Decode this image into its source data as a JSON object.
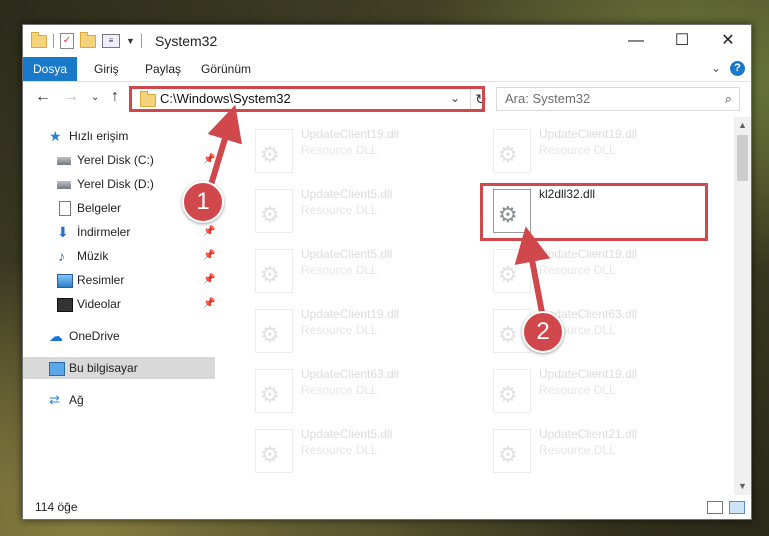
{
  "window": {
    "title": "System32",
    "controls": {
      "minimize": "—",
      "maximize": "☐",
      "close": "✕"
    }
  },
  "ribbon": {
    "tabs": [
      "Dosya",
      "Giriş",
      "Paylaş",
      "Görünüm"
    ],
    "help": "?"
  },
  "nav": {
    "address": "C:\\Windows\\System32",
    "search_placeholder": "Ara: System32"
  },
  "sidebar": {
    "items": [
      {
        "label": "Hızlı erişim",
        "icon": "star-icon"
      },
      {
        "label": "Yerel Disk (C:)",
        "icon": "drive-icon"
      },
      {
        "label": "Yerel Disk (D:)",
        "icon": "drive-icon"
      },
      {
        "label": "Belgeler",
        "icon": "documents-icon"
      },
      {
        "label": "İndirmeler",
        "icon": "downloads-icon"
      },
      {
        "label": "Müzik",
        "icon": "music-icon"
      },
      {
        "label": "Resimler",
        "icon": "pictures-icon"
      },
      {
        "label": "Videolar",
        "icon": "videos-icon"
      },
      {
        "label": "OneDrive",
        "icon": "onedrive-icon"
      },
      {
        "label": "Bu bilgisayar",
        "icon": "this-pc-icon"
      },
      {
        "label": "Ağ",
        "icon": "network-icon"
      }
    ]
  },
  "files": [
    {
      "name": "UpdateClient19.dll",
      "type": "Resource DLL"
    },
    {
      "name": "UpdateClient19.dll",
      "type": "Resource DLL"
    },
    {
      "name": "UpdateClient5.dll",
      "type": "Resource DLL"
    },
    {
      "name": "kl2dll32.dll",
      "type": ""
    },
    {
      "name": "UpdateClient5.dll",
      "type": "Resource DLL"
    },
    {
      "name": "UpdateClient19.dll",
      "type": "Resource DLL"
    },
    {
      "name": "UpdateClient19.dll",
      "type": "Resource DLL"
    },
    {
      "name": "UpdateClient63.dll",
      "type": "Resource DLL"
    },
    {
      "name": "UpdateClient63.dll",
      "type": "Resource DLL"
    },
    {
      "name": "UpdateClient19.dll",
      "type": "Resource DLL"
    },
    {
      "name": "UpdateClient5.dll",
      "type": "Resource DLL"
    },
    {
      "name": "UpdateClient21.dll",
      "type": "Resource DLL"
    }
  ],
  "status": {
    "count": "114 öğe"
  },
  "annotations": {
    "step1": "1",
    "step2": "2",
    "color": "#d0474c"
  }
}
